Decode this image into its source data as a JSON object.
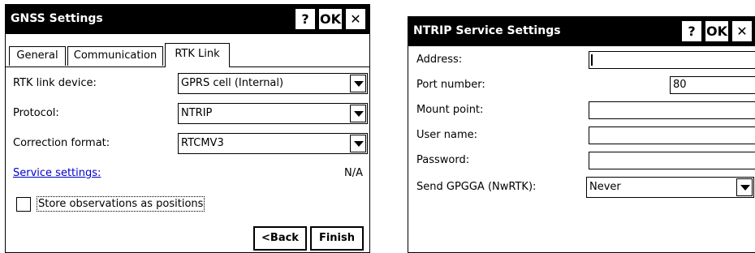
{
  "gnss": {
    "title": "GNSS Settings",
    "help_label": "?",
    "ok_label": "OK",
    "close_label": "✕",
    "tabs": [
      {
        "label": "General"
      },
      {
        "label": "Communication"
      },
      {
        "label": "RTK Link"
      }
    ],
    "fields": {
      "rtk_link_device": {
        "label": "RTK link device:",
        "value": "GPRS cell (Internal)"
      },
      "protocol": {
        "label": "Protocol:",
        "value": "NTRIP"
      },
      "correction_format": {
        "label": "Correction format:",
        "value": "RTCMV3"
      }
    },
    "service_settings": {
      "label": "Service settings:",
      "value": "N/A"
    },
    "store_obs_label": "Store observations as positions",
    "back_label": "<Back",
    "finish_label": "Finish"
  },
  "ntrip": {
    "title": "NTRIP Service Settings",
    "help_label": "?",
    "ok_label": "OK",
    "close_label": "✕",
    "fields": {
      "address": {
        "label": "Address:",
        "value": ""
      },
      "port": {
        "label": "Port number:",
        "value": "80"
      },
      "mount_point": {
        "label": "Mount point:",
        "value": ""
      },
      "user_name": {
        "label": "User name:",
        "value": ""
      },
      "password": {
        "label": "Password:",
        "value": ""
      },
      "send_gpgga": {
        "label": "Send GPGGA (NwRTK):",
        "value": "Never"
      }
    }
  }
}
